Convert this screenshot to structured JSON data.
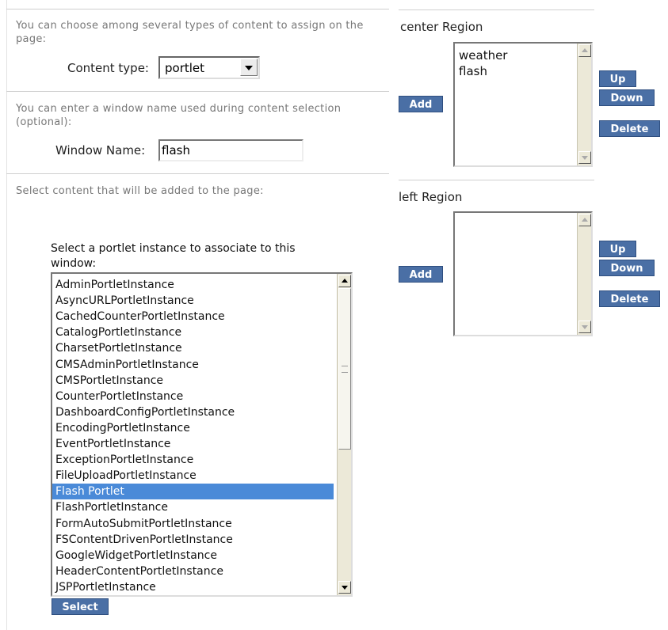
{
  "content_section": {
    "help": "You can choose among several types of content to assign on the page:",
    "label": "Content type:",
    "value": "portlet"
  },
  "window_section": {
    "help": "You can enter a window name used during content selection (optional):",
    "label": "Window Name:",
    "value": "flash"
  },
  "select_section": {
    "help": "Select content that will be added to the page:",
    "instruction": "Select a portlet instance to associate to this window:",
    "items": [
      "AdminPortletInstance",
      "AsyncURLPortletInstance",
      "CachedCounterPortletInstance",
      "CatalogPortletInstance",
      "CharsetPortletInstance",
      "CMSAdminPortletInstance",
      "CMSPortletInstance",
      "CounterPortletInstance",
      "DashboardConfigPortletInstance",
      "EncodingPortletInstance",
      "EventPortletInstance",
      "ExceptionPortletInstance",
      "FileUploadPortletInstance",
      "Flash Portlet",
      "FlashPortletInstance",
      "FormAutoSubmitPortletInstance",
      "FSContentDrivenPortletInstance",
      "GoogleWidgetPortletInstance",
      "HeaderContentPortletInstance",
      "JSPPortletInstance"
    ],
    "selected": "Flash Portlet",
    "select_button": "Select"
  },
  "regions": {
    "center": {
      "title": "center Region",
      "items": [
        "weather",
        "flash"
      ],
      "add": "Add",
      "up": "Up",
      "down": "Down",
      "delete": "Delete"
    },
    "left": {
      "title": "left Region",
      "items": [],
      "add": "Add",
      "up": "Up",
      "down": "Down",
      "delete": "Delete"
    }
  },
  "colors": {
    "button_bg": "#4a6fa5",
    "selection_bg": "#4a8ad8",
    "help_text": "#777777"
  }
}
